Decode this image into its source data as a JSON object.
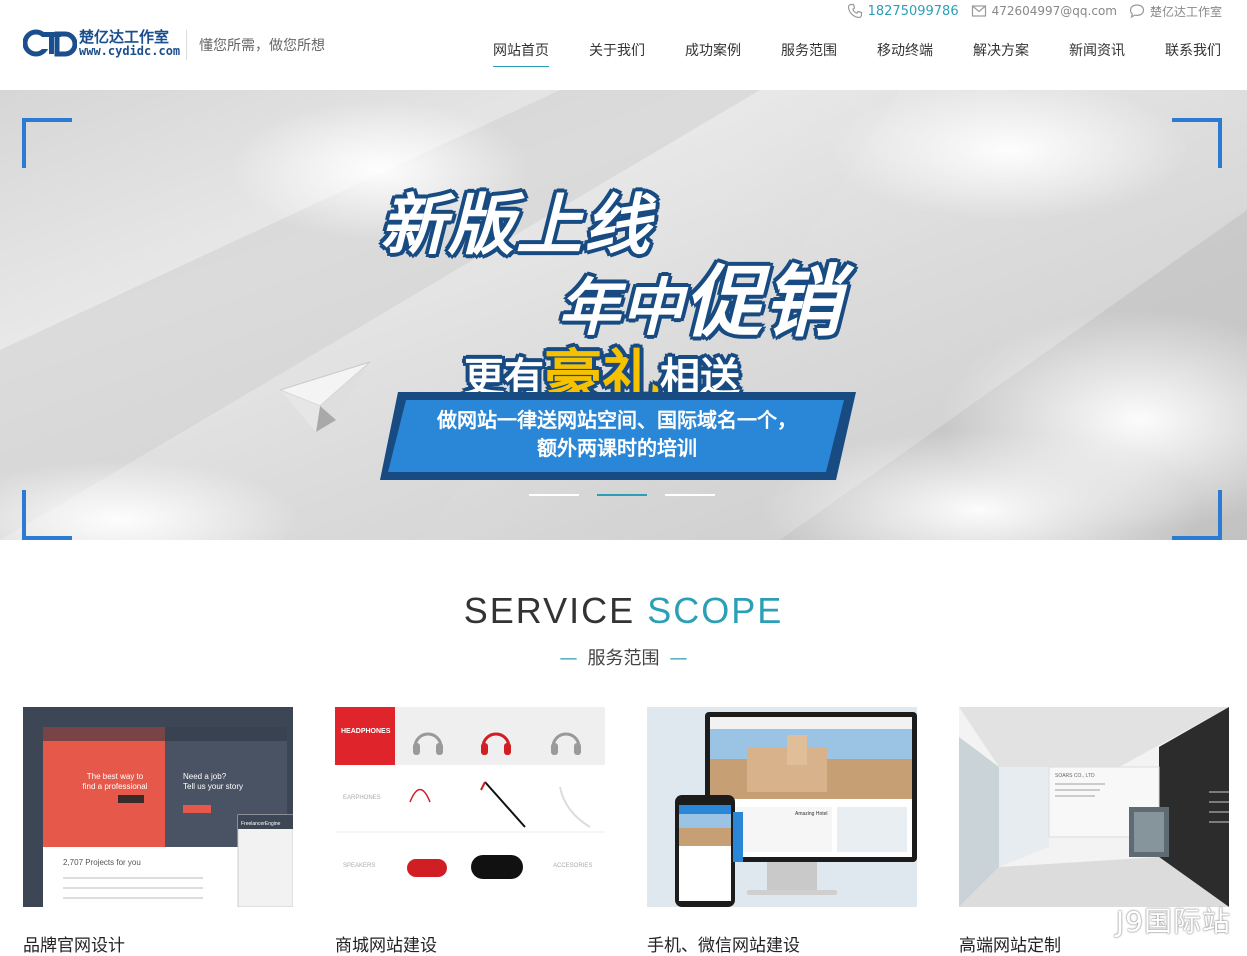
{
  "brand": {
    "logo_mark": "CYD",
    "name_cn": "楚亿达工作室",
    "url": "www.cydidc.com",
    "slogan": "懂您所需，做您所想"
  },
  "topbar": {
    "phone": "18275099786",
    "email": "472604997@qq.com",
    "studio": "楚亿达工作室"
  },
  "nav": {
    "items": [
      {
        "label": "网站首页",
        "active": true
      },
      {
        "label": "关于我们"
      },
      {
        "label": "成功案例"
      },
      {
        "label": "服务范围"
      },
      {
        "label": "移动终端"
      },
      {
        "label": "解决方案"
      },
      {
        "label": "新闻资讯"
      },
      {
        "label": "联系我们"
      }
    ]
  },
  "banner": {
    "line1": "新版上线",
    "line2_a": "年中",
    "line2_b": "促销",
    "line3_a": "更有",
    "line3_gold": "豪礼",
    "line3_b": "相送",
    "promo_line1": "做网站一律送网站空间、国际域名一个，",
    "promo_line2": "额外两课时的培训",
    "slides": 3,
    "active_slide": 2
  },
  "service": {
    "title_a": "SERVICE",
    "title_b": "SCOPE",
    "subtitle": "服务范围",
    "cards": [
      {
        "title": "品牌官网设计",
        "mock_text1": "The best way to",
        "mock_text2": "find a professional",
        "mock_text3": "Need a job?",
        "mock_text4": "Tell us your story",
        "mock_text5": "2,707 Projects for you",
        "mock_text6": "FreelancerEngine"
      },
      {
        "title": "商城网站建设",
        "mock_text1": "HEADPHONES",
        "mock_text2": "EARPHONES",
        "mock_text3": "SPEAKERS",
        "mock_text4": "ACCESORIES"
      },
      {
        "title": "手机、微信网站建设",
        "mock_text1": "Amazing Hotel"
      },
      {
        "title": "高端网站定制",
        "mock_text1": "SOARS CO., LTD"
      }
    ]
  },
  "watermark": "J9国际站",
  "colors": {
    "accent": "#2a9fb5",
    "brand_blue": "#1a4e8c",
    "banner_blue": "#174b82",
    "gold": "#f6c200",
    "corner_blue": "#2a7bd1"
  }
}
